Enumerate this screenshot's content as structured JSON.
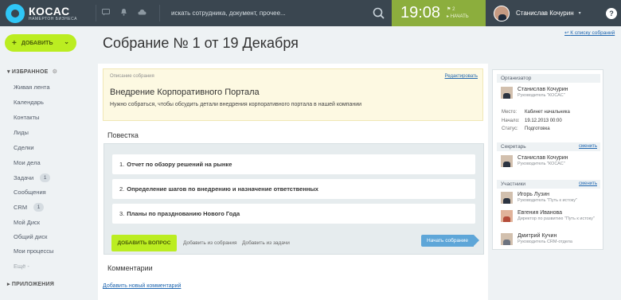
{
  "topbar": {
    "logo_name": "КОСАС",
    "logo_sub": "НАМЕРТОН БИЗНЕСА",
    "search_placeholder": "искать сотрудника, документ, прочее...",
    "clock_time": "19:08",
    "clock_count": "2",
    "clock_start": "НАЧАТЬ",
    "user_name": "Станислав Кочурин",
    "help": "?"
  },
  "sidebar": {
    "add_label": "ДОБАВИТЬ",
    "favorites_label": "ИЗБРАННОЕ",
    "items": [
      {
        "label": "Живая лента",
        "count": ""
      },
      {
        "label": "Календарь",
        "count": ""
      },
      {
        "label": "Контакты",
        "count": ""
      },
      {
        "label": "Лиды",
        "count": ""
      },
      {
        "label": "Сделки",
        "count": ""
      },
      {
        "label": "Мои дела",
        "count": ""
      },
      {
        "label": "Задачи",
        "count": "1"
      },
      {
        "label": "Сообщения",
        "count": ""
      },
      {
        "label": "CRM",
        "count": "1"
      },
      {
        "label": "Мой Диск",
        "count": ""
      },
      {
        "label": "Общий диск",
        "count": ""
      },
      {
        "label": "Мои процессы",
        "count": ""
      }
    ],
    "more_label": "Ещё -",
    "apps_label": "ПРИЛОЖЕНИЯ"
  },
  "page": {
    "title": "Собрание № 1 от 19 Декабря",
    "back_link": "К списку собраний"
  },
  "description": {
    "caption": "Описание собрания",
    "edit": "Редактировать",
    "title": "Внедрение Корпоративного Портала",
    "text": "Нужно собраться, чтобы обсудить детали внедрения корпоративного портала в нашей компании"
  },
  "agenda": {
    "heading": "Повестка",
    "items": [
      {
        "num": "1.",
        "text": "Отчет по обзору решений на рынке"
      },
      {
        "num": "2.",
        "text": "Определение шагов по внедрению и назначение ответственных"
      },
      {
        "num": "3.",
        "text": "Планы по празднованию Нового Года"
      }
    ],
    "add_question": "ДОБАВИТЬ ВОПРОС",
    "add_from_meeting": "Добавить из собрания",
    "add_from_task": "Добавить из задачи",
    "start_meeting": "Начать собрание"
  },
  "comments": {
    "heading": "Комментарии",
    "add_comment": "Добавить новый комментарий"
  },
  "sidepanel": {
    "organizer_label": "Организатор",
    "organizer": {
      "name": "Станислав Кочурин",
      "role": "Руководитель \"КОСАС\""
    },
    "place_label": "Место:",
    "place_value": "Кабинет начальника",
    "start_label": "Начало:",
    "start_value": "19.12.2013 00:00",
    "status_label": "Статус:",
    "status_value": "Подготовка",
    "secretary_label": "Секретарь",
    "change": "сменить",
    "secretary": {
      "name": "Станислав Кочурин",
      "role": "Руководитель \"КОСАС\""
    },
    "participants_label": "Участники",
    "participants": [
      {
        "name": "Игорь Лузин",
        "role": "Руководитель \"Путь к истоку\""
      },
      {
        "name": "Евгения Иванова",
        "role": "Директор по развитию \"Путь к истоку\""
      },
      {
        "name": "Дмитрий Кучин",
        "role": "Руководитель CRM-отдела"
      }
    ]
  },
  "colors": {
    "topbar": "#3a4650",
    "accent_green": "#bbed21",
    "clock_green": "#8cae3d",
    "link_blue": "#2067b0"
  }
}
